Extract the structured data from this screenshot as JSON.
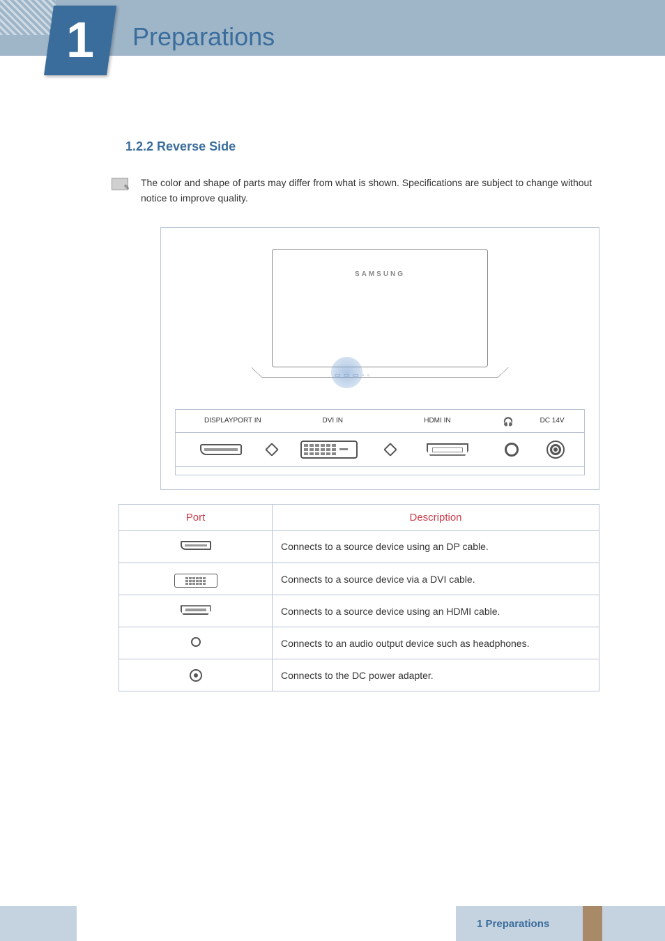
{
  "chapter": {
    "number": "1",
    "title": "Preparations"
  },
  "section": {
    "numberTitle": "1.2.2  Reverse Side"
  },
  "note": "The color and shape of parts may differ from what is shown. Specifications are subject to change without notice to improve quality.",
  "monitor": {
    "brand": "SAMSUNG",
    "portDots": "▭ ▭ ▭  ◦ ◦"
  },
  "portStrip": {
    "labels": {
      "displayport": "DISPLAYPORT IN",
      "dvi": "DVI IN",
      "hdmi": "HDMI IN",
      "dc": "DC 14V"
    }
  },
  "table": {
    "headers": {
      "port": "Port",
      "desc": "Description"
    },
    "rows": [
      {
        "icon": "dp",
        "desc": "Connects to a source device using an DP cable."
      },
      {
        "icon": "dvi",
        "desc": "Connects to a source device via a DVI cable."
      },
      {
        "icon": "hdmi",
        "desc": "Connects to a source device using an HDMI cable."
      },
      {
        "icon": "jack",
        "desc": "Connects to an audio output device such as headphones."
      },
      {
        "icon": "dc",
        "desc": "Connects to the DC power adapter."
      }
    ]
  },
  "footer": {
    "text": "1 Preparations"
  }
}
